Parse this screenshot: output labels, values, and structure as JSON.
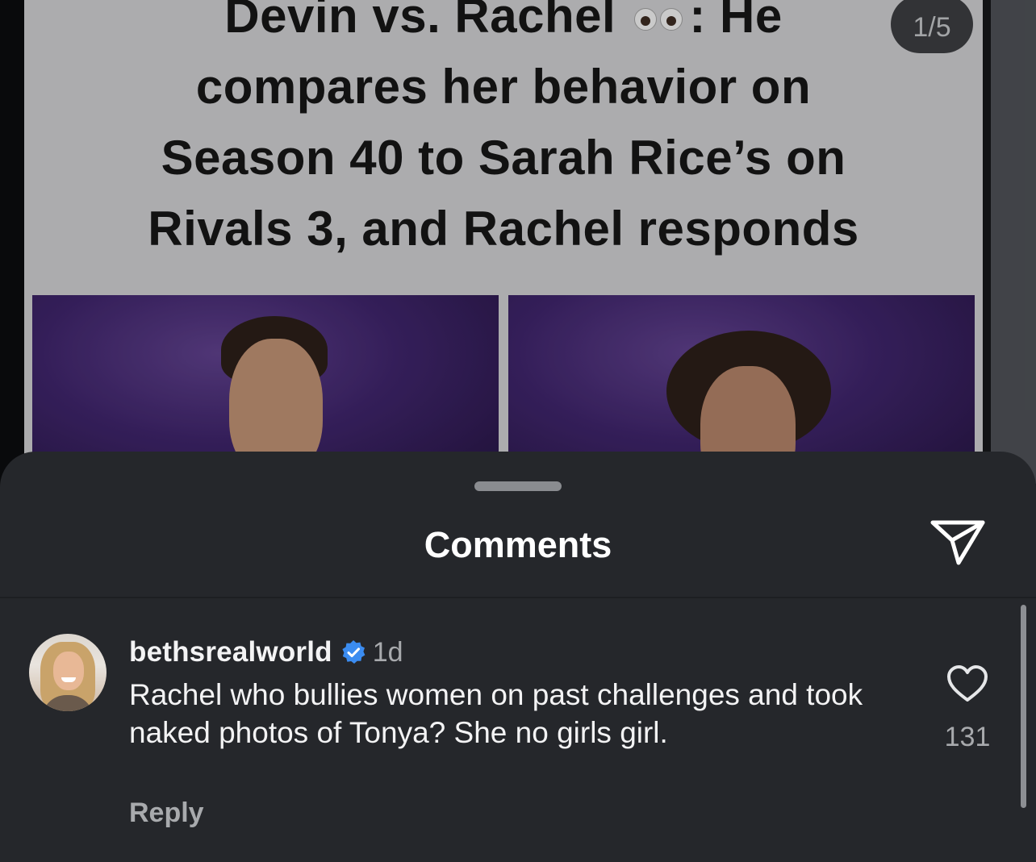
{
  "post": {
    "title_line1_before": "Devin vs. Rachel",
    "title_line1_after": ": He",
    "title_line2": "compares her behavior on",
    "title_line3": "Season 40 to Sarah Rice’s on",
    "title_line4": "Rivals 3, and Rachel responds",
    "slide_counter": "1/5",
    "emoji": "eyes-emoji"
  },
  "comments_sheet": {
    "title": "Comments",
    "share_icon": "paper-plane-icon",
    "comments": [
      {
        "username": "bethsrealworld",
        "verified": true,
        "verified_icon": "verified-badge-icon",
        "time": "1d",
        "text": "Rachel who bullies women on past challenges and took naked photos of Tonya?  She no girls girl.",
        "reply_label": "Reply",
        "like_icon": "heart-outline-icon",
        "like_count": "131"
      }
    ]
  },
  "colors": {
    "sheet_background": "#25272b",
    "verified_blue": "#3b8cf0",
    "text_primary": "#f3f3f4",
    "text_secondary": "#a8aaad"
  }
}
